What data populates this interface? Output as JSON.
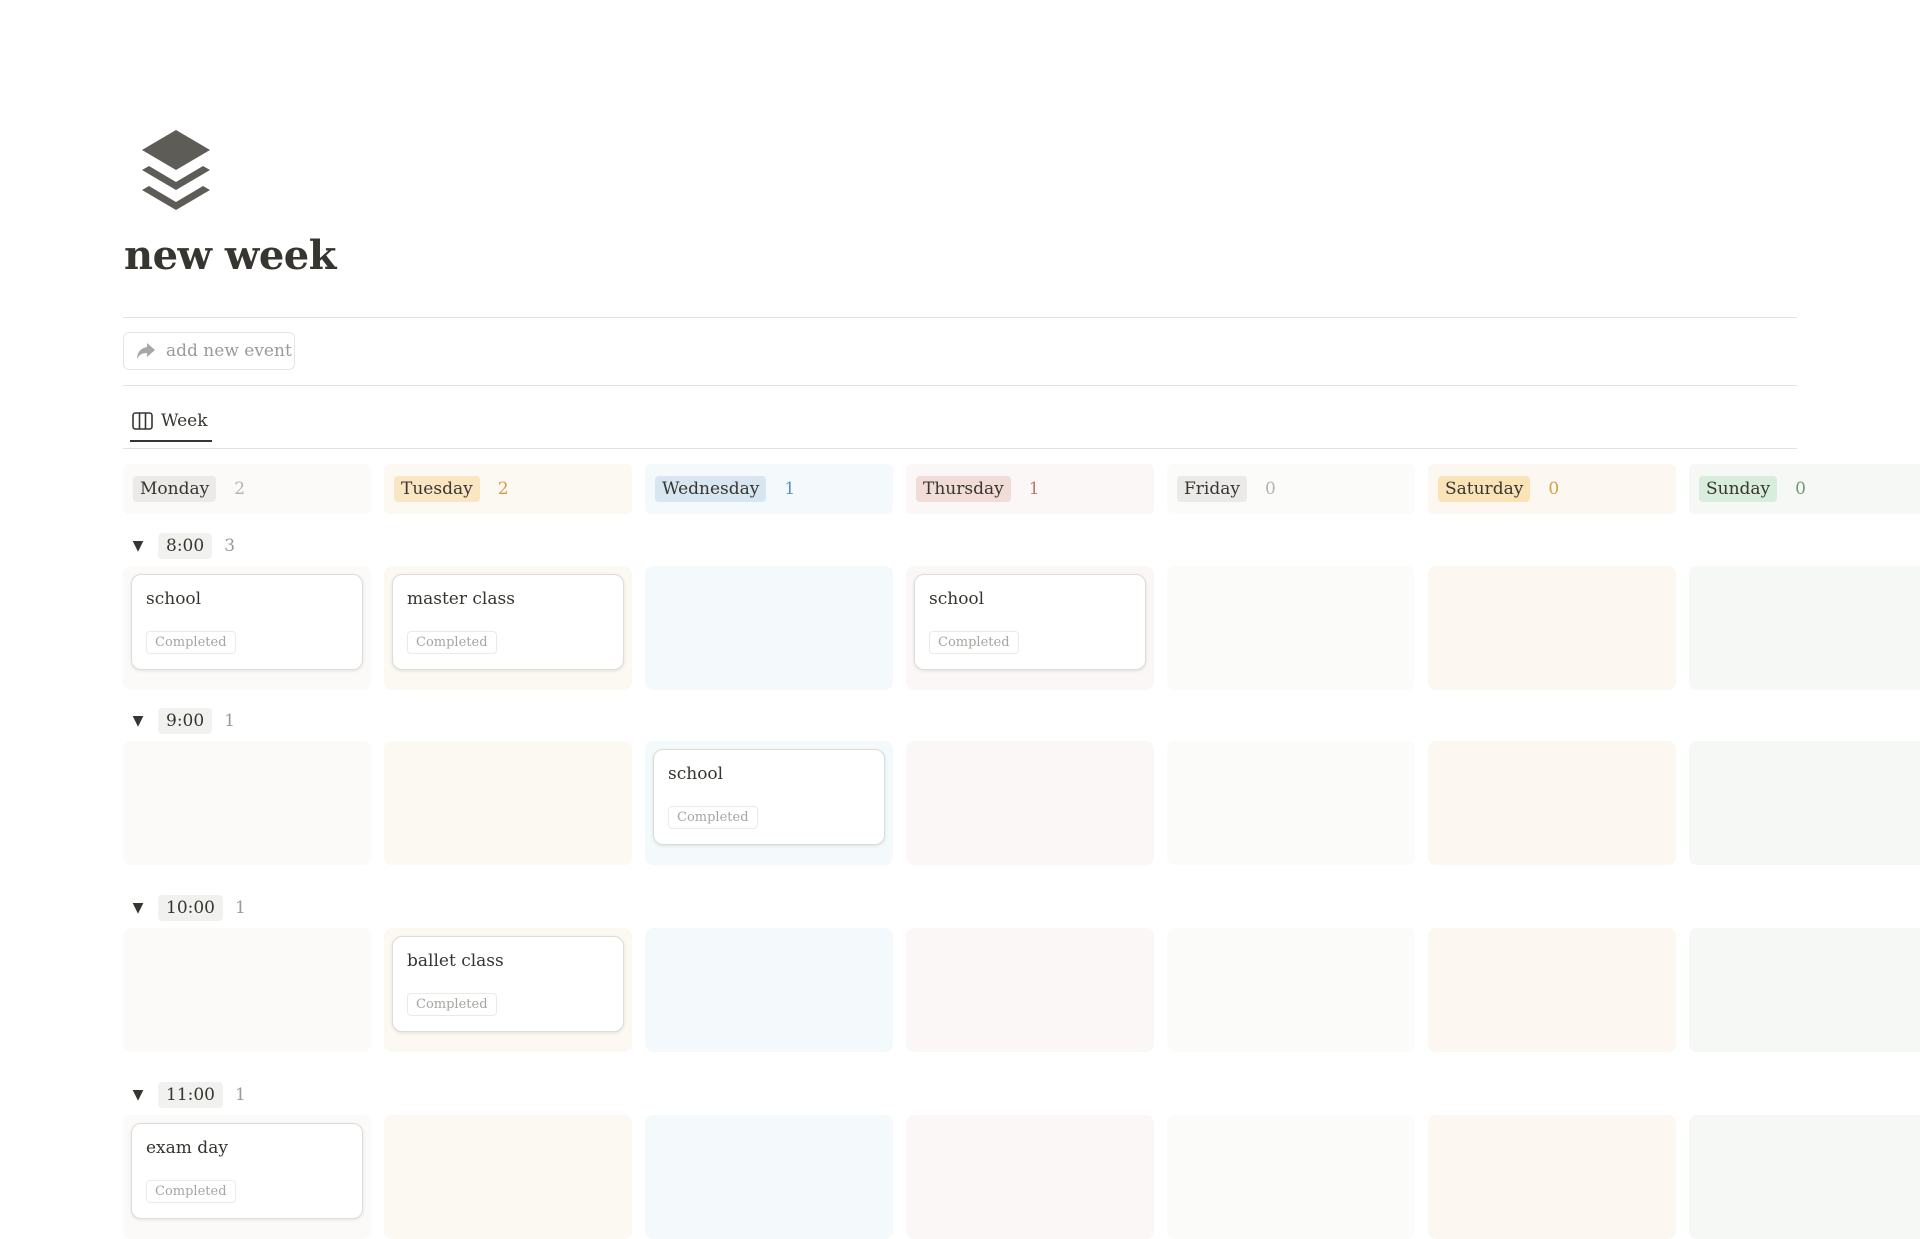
{
  "page": {
    "title": "new week",
    "icon": "stack-layers-icon"
  },
  "toolbar": {
    "add_label": "add new event",
    "add_icon": "share-arrow-icon"
  },
  "view": {
    "label": "Week",
    "icon": "board-columns-icon"
  },
  "days": [
    {
      "label": "Monday",
      "count": "2",
      "pill_bg": "#ebeae8",
      "count_color": "#b4b3ae",
      "col_bg": "#fbfaf9"
    },
    {
      "label": "Tuesday",
      "count": "2",
      "pill_bg": "#fbe6c4",
      "count_color": "#d69a4a",
      "col_bg": "#fcf8f2"
    },
    {
      "label": "Wednesday",
      "count": "1",
      "pill_bg": "#d7e6f0",
      "count_color": "#5f93b8",
      "col_bg": "#f4f9fc"
    },
    {
      "label": "Thursday",
      "count": "1",
      "pill_bg": "#f2dcd7",
      "count_color": "#c77762",
      "col_bg": "#faf7f6"
    },
    {
      "label": "Friday",
      "count": "0",
      "pill_bg": "#ebeae8",
      "count_color": "#b4b3ae",
      "col_bg": "#fbfbfa"
    },
    {
      "label": "Saturday",
      "count": "0",
      "pill_bg": "#fbe3b8",
      "count_color": "#d4a04a",
      "col_bg": "#fcf8f1"
    },
    {
      "label": "Sunday",
      "count": "0",
      "pill_bg": "#d8eddb",
      "count_color": "#6b9e74",
      "col_bg": "#f6f8f5"
    }
  ],
  "groups": [
    {
      "time": "8:00",
      "count": "3",
      "cards": [
        {
          "day": 0,
          "title": "school",
          "status": "Completed"
        },
        {
          "day": 1,
          "title": "master class",
          "status": "Completed"
        },
        {
          "day": 3,
          "title": "school",
          "status": "Completed"
        }
      ]
    },
    {
      "time": "9:00",
      "count": "1",
      "cards": [
        {
          "day": 2,
          "title": "school",
          "status": "Completed"
        }
      ]
    },
    {
      "time": "10:00",
      "count": "1",
      "cards": [
        {
          "day": 1,
          "title": "ballet class",
          "status": "Completed"
        }
      ]
    },
    {
      "time": "11:00",
      "count": "1",
      "cards": [
        {
          "day": 0,
          "title": "exam day",
          "status": "Completed"
        }
      ]
    }
  ],
  "colors": {
    "text": "#37352f",
    "muted": "#9b9a97",
    "divider": "#e3e2df",
    "icon": "#5e5c56"
  }
}
